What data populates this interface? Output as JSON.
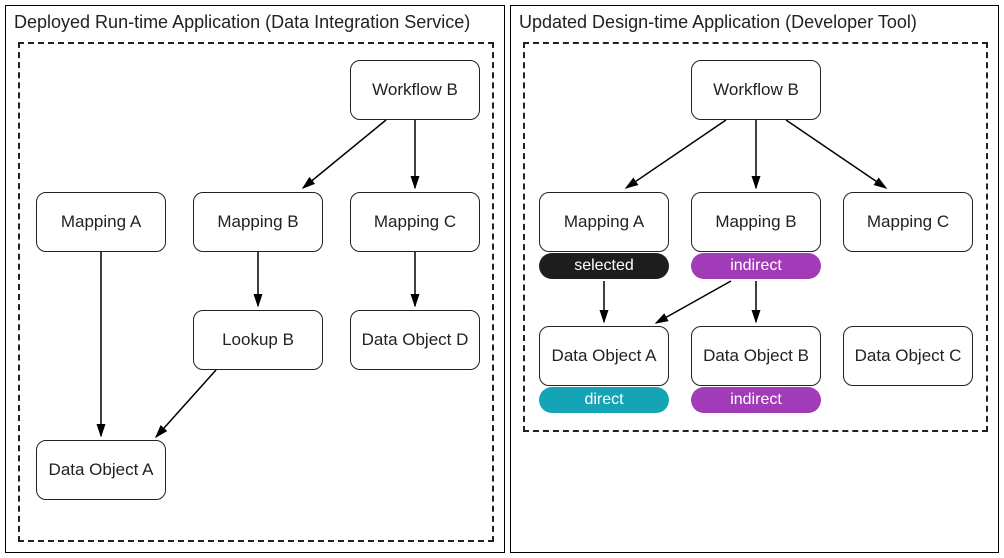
{
  "left": {
    "title": "Deployed Run-time Application (Data Integration Service)",
    "nodes": {
      "workflow_b": "Workflow B",
      "mapping_a": "Mapping A",
      "mapping_b": "Mapping B",
      "mapping_c": "Mapping C",
      "lookup_b": "Lookup B",
      "data_object_d": "Data Object D",
      "data_object_a": "Data Object A"
    }
  },
  "right": {
    "title": "Updated Design-time Application (Developer Tool)",
    "nodes": {
      "workflow_b": "Workflow B",
      "mapping_a": "Mapping A",
      "mapping_b": "Mapping B",
      "mapping_c": "Mapping C",
      "data_object_a": "Data Object A",
      "data_object_b": "Data Object B",
      "data_object_c": "Data Object C"
    },
    "badges": {
      "selected": "selected",
      "indirect": "indirect",
      "direct": "direct"
    }
  },
  "chart_data": {
    "type": "diagram",
    "title": "Application object dependency comparison",
    "panels": [
      {
        "name": "Deployed Run-time Application (Data Integration Service)",
        "nodes": [
          "Workflow B",
          "Mapping A",
          "Mapping B",
          "Mapping C",
          "Lookup B",
          "Data Object D",
          "Data Object A"
        ],
        "edges": [
          [
            "Workflow B",
            "Mapping B"
          ],
          [
            "Workflow B",
            "Mapping C"
          ],
          [
            "Mapping A",
            "Data Object A"
          ],
          [
            "Mapping B",
            "Lookup B"
          ],
          [
            "Mapping C",
            "Data Object D"
          ],
          [
            "Lookup B",
            "Data Object A"
          ]
        ]
      },
      {
        "name": "Updated Design-time Application (Developer Tool)",
        "nodes": [
          "Workflow B",
          "Mapping A",
          "Mapping B",
          "Mapping C",
          "Data Object A",
          "Data Object B",
          "Data Object C"
        ],
        "edges": [
          [
            "Workflow B",
            "Mapping A"
          ],
          [
            "Workflow B",
            "Mapping B"
          ],
          [
            "Workflow B",
            "Mapping C"
          ],
          [
            "Mapping A",
            "Data Object A"
          ],
          [
            "Mapping B",
            "Data Object A"
          ],
          [
            "Mapping B",
            "Data Object B"
          ]
        ],
        "annotations": {
          "Mapping A": "selected",
          "Mapping B": "indirect",
          "Data Object A": "direct",
          "Data Object B": "indirect"
        }
      }
    ]
  }
}
